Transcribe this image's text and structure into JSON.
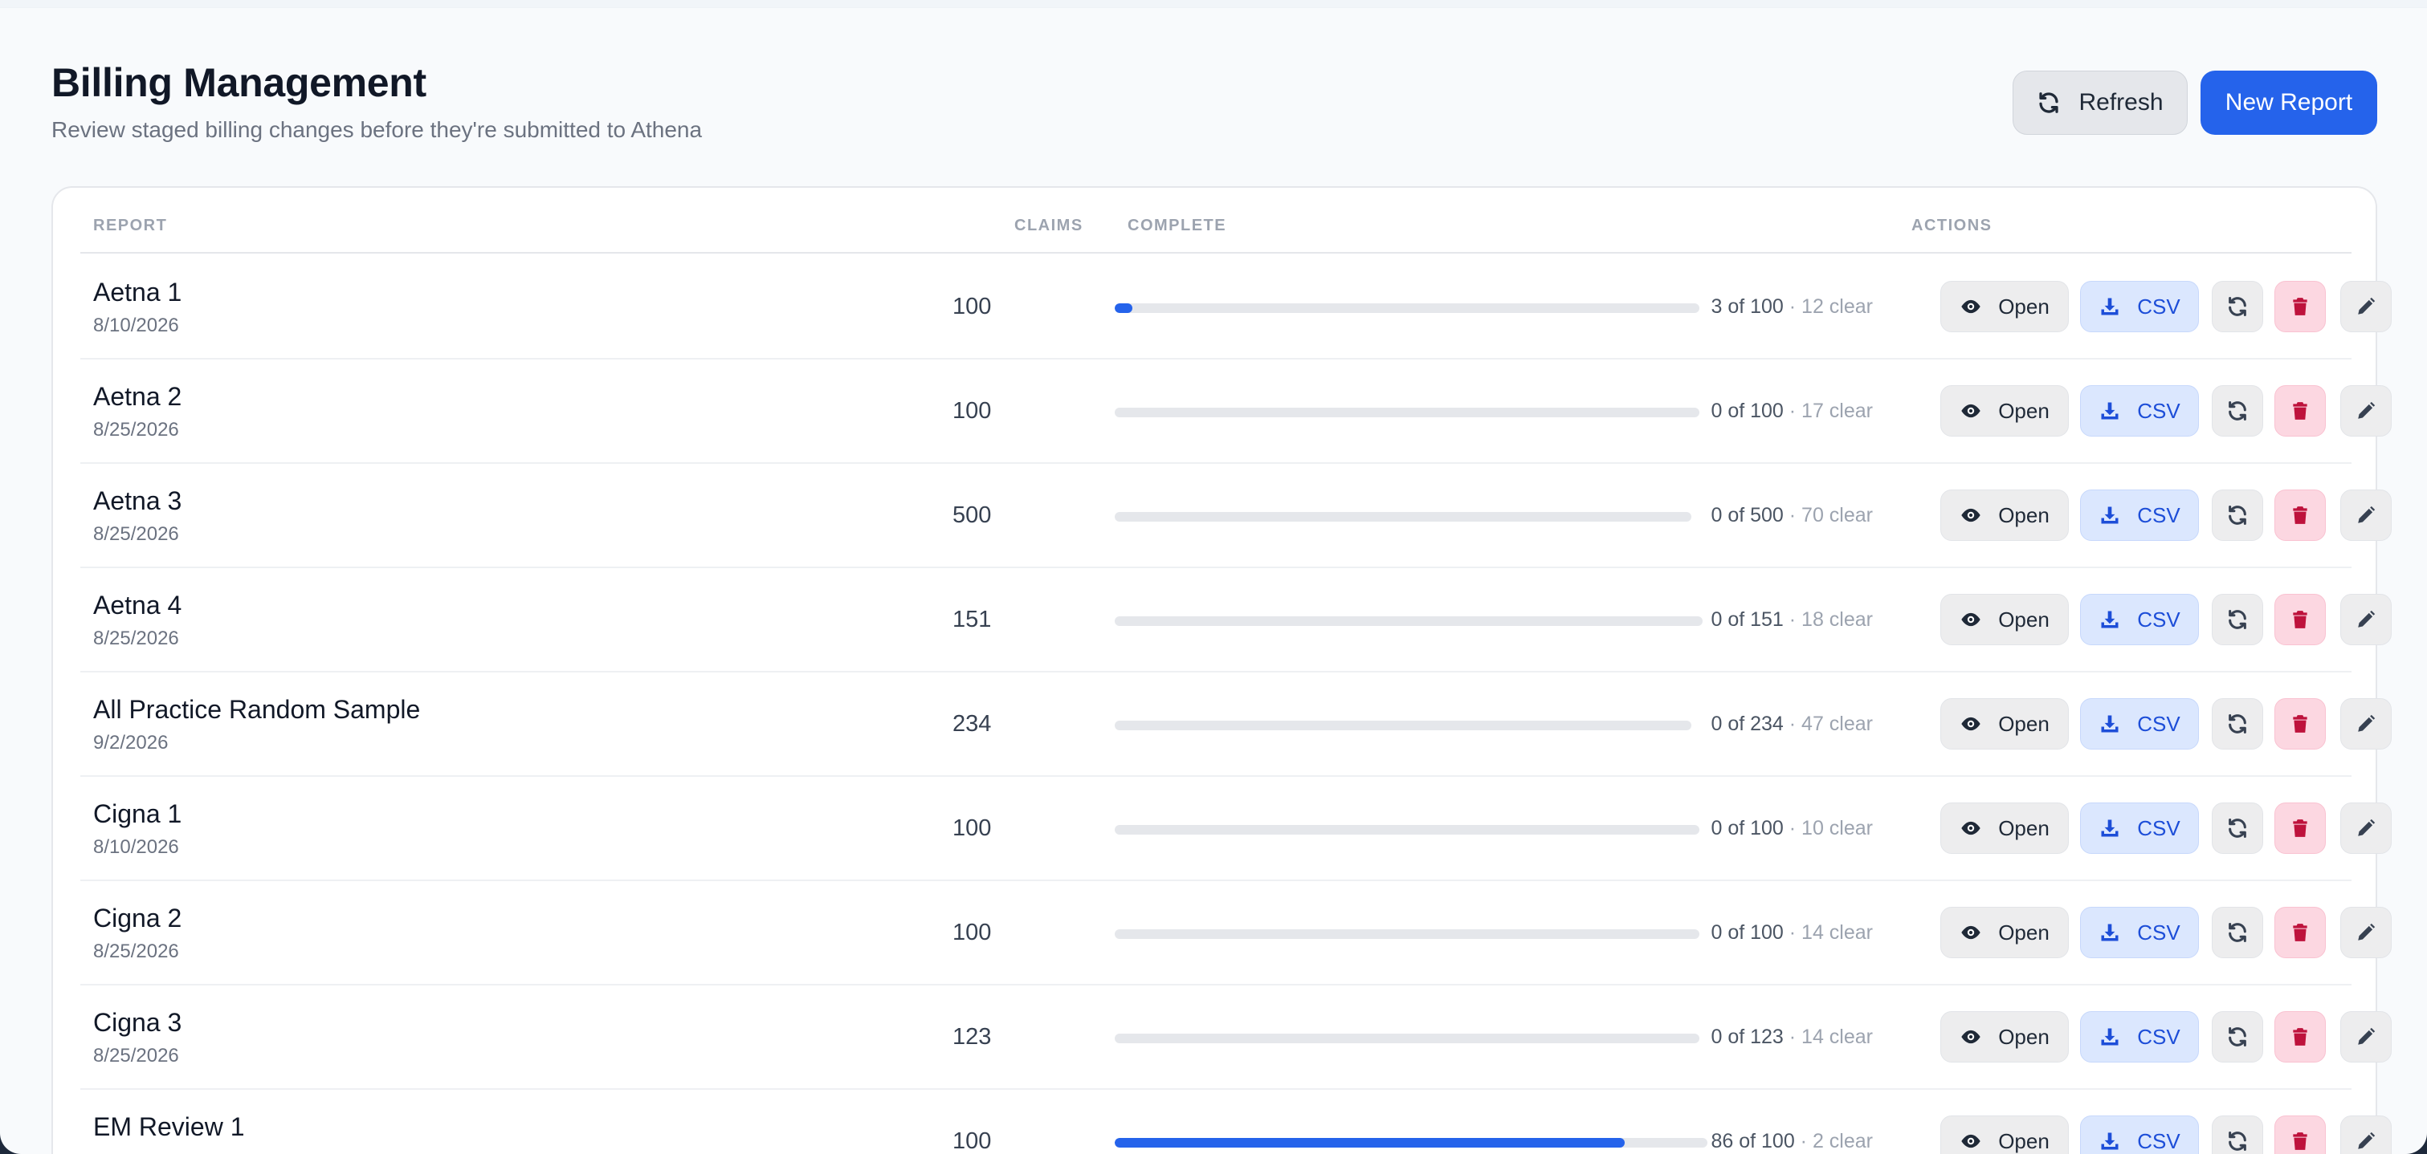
{
  "header": {
    "title": "Billing Management",
    "subtitle": "Review staged billing changes before they're submitted to Athena",
    "refresh_label": "Refresh",
    "new_report_label": "New Report"
  },
  "table": {
    "columns": {
      "report": "REPORT",
      "claims": "CLAIMS",
      "complete": "COMPLETE",
      "actions": "ACTIONS"
    },
    "action_labels": {
      "open": "Open",
      "csv": "CSV"
    },
    "rows": [
      {
        "name": "Aetna 1",
        "date": "8/10/2026",
        "claims": "100",
        "done": "3 of 100",
        "clear": " · 12 clear",
        "progress": 0.03
      },
      {
        "name": "Aetna 2",
        "date": "8/25/2026",
        "claims": "100",
        "done": "0 of 100",
        "clear": " · 17 clear",
        "progress": 0
      },
      {
        "name": "Aetna 3",
        "date": "8/25/2026",
        "claims": "500",
        "done": "0 of 500",
        "clear": " · 70 clear",
        "progress": 0
      },
      {
        "name": "Aetna 4",
        "date": "8/25/2026",
        "claims": "151",
        "done": "0 of 151",
        "clear": " · 18 clear",
        "progress": 0
      },
      {
        "name": "All Practice Random Sample",
        "date": "9/2/2026",
        "claims": "234",
        "done": "0 of 234",
        "clear": " · 47 clear",
        "progress": 0
      },
      {
        "name": "Cigna 1",
        "date": "8/10/2026",
        "claims": "100",
        "done": "0 of 100",
        "clear": " · 10 clear",
        "progress": 0
      },
      {
        "name": "Cigna 2",
        "date": "8/25/2026",
        "claims": "100",
        "done": "0 of 100",
        "clear": " · 14 clear",
        "progress": 0
      },
      {
        "name": "Cigna 3",
        "date": "8/25/2026",
        "claims": "123",
        "done": "0 of 123",
        "clear": " · 14 clear",
        "progress": 0
      },
      {
        "name": "EM Review 1",
        "date": "",
        "claims": "100",
        "done": "86 of 100",
        "clear": " · 2 clear",
        "progress": 0.86
      }
    ]
  },
  "colors": {
    "accent": "#2563eb",
    "csv_bg": "#dbe7fe",
    "delete_bg": "#fcd7e1",
    "delete_icon": "#be123c"
  },
  "icons": {
    "refresh": "refresh-icon",
    "open": "eye-icon",
    "csv": "download-icon",
    "resync": "sync-icon",
    "delete": "trash-icon",
    "edit": "pencil-icon"
  }
}
